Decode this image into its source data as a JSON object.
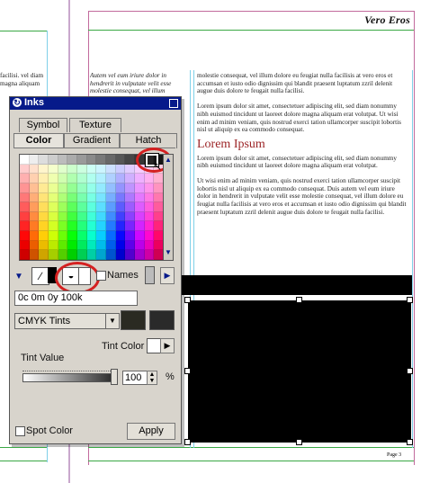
{
  "document": {
    "header_title": "Vero Eros",
    "left_column_text": "facilisi. vel diam magna aliquam",
    "middle_column_text": "Autem vel eum iriure dolor in hendrerit in vulputate velit esse molestie consequat, vel illum",
    "right_column_paragraph_1": "molestie consequat, vel illum dolore eu feugiat nulla facilisis at vero eros et accumsan et iusto odio dignissim qui blandit praesent luptatum zzril delenit augue duis dolore te feugait nulla facilisi.",
    "right_column_paragraph_2": "Lorem ipsum dolor sit amet, consectetuer adipiscing elit, sed diam nonummy nibh euismod tincidunt ut laoreet dolore magna aliquam erat volutpat. Ut wisi enim ad minim veniam, quis nostrud exerci tation ullamcorper suscipit lobortis nisl ut aliquip ex ea commodo consequat.",
    "heading": "Lorem Ipsum",
    "right_column_paragraph_3": "Lorem ipsum dolor sit amet, consectetuer adipiscing elit, sed diam nonummy nibh euismod tincidunt ut laoreet dolore magna aliquam erat volutpat.",
    "right_column_paragraph_4": "Ut wisi enim ad minim veniam, quis nostrud exerci tation ullamcorper suscipit lobortis nisl ut aliquip ex ea commodo consequat. Duis autem vel eum iriure dolor in hendrerit in vulputate velit esse molestie consequat, vel illum dolore eu feugiat nulla facilisis at vero eros et accumsan et iusto odio dignissim qui blandit praesent luptatum zzril delenit augue duis dolore te feugait nulla facilisi.",
    "page_footer": "Page 3"
  },
  "inks_palette": {
    "title": "Inks",
    "tabs_row1": [
      "Symbol",
      "Texture"
    ],
    "tabs_row2": [
      "Color",
      "Gradient",
      "Hatch"
    ],
    "active_tab": "Color",
    "color_value": "0c 0m 0y 100k",
    "names_label": "Names",
    "tint_mode": "CMYK Tints",
    "tint_color_label": "Tint Color",
    "tint_value_label": "Tint Value",
    "tint_value": "100",
    "tint_fraction": 1.0,
    "percent_symbol": "%",
    "spot_color_label": "Spot Color",
    "apply_label": "Apply"
  },
  "colors": {
    "title_bar": "#061a8a",
    "accent_red": "#d42020",
    "selected_swatch": "#2a2a2a"
  }
}
